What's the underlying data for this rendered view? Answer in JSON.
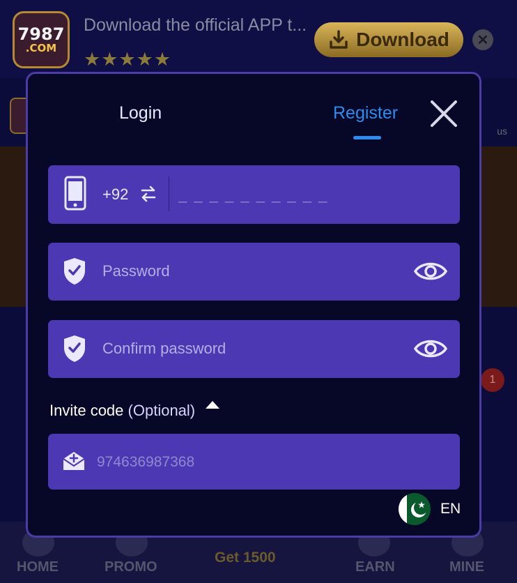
{
  "background": {
    "app_logo": {
      "line1": "7987",
      "line2": ".COM"
    },
    "promo_text": "Download the official APP t...",
    "stars": "★★★★★",
    "download_label": "Download",
    "close_symbol": "✕",
    "bonus_text": "us",
    "badge_count": "1",
    "bottom_nav": {
      "home": "HOME",
      "promo": "PROMO",
      "get": "Get 1500",
      "earn": "EARN",
      "mine": "MINE"
    }
  },
  "modal": {
    "tabs": {
      "login": "Login",
      "register": "Register"
    },
    "active_tab": "register",
    "phone": {
      "country_code": "+92",
      "placeholder": "_ _ _ _ _ _ _ _ _ _",
      "value": ""
    },
    "password": {
      "placeholder": "Password",
      "value": ""
    },
    "confirm_password": {
      "placeholder": "Confirm password",
      "value": ""
    },
    "invite": {
      "label": "Invite code",
      "optional": "(Optional)",
      "placeholder": "974636987368",
      "value": ""
    },
    "language": {
      "code": "EN",
      "flag": "pakistan-flag"
    },
    "colors": {
      "accent": "#2d8cf0",
      "field": "#4c38b3",
      "modal_bg": "#070728",
      "border": "#4b3ca6"
    }
  }
}
